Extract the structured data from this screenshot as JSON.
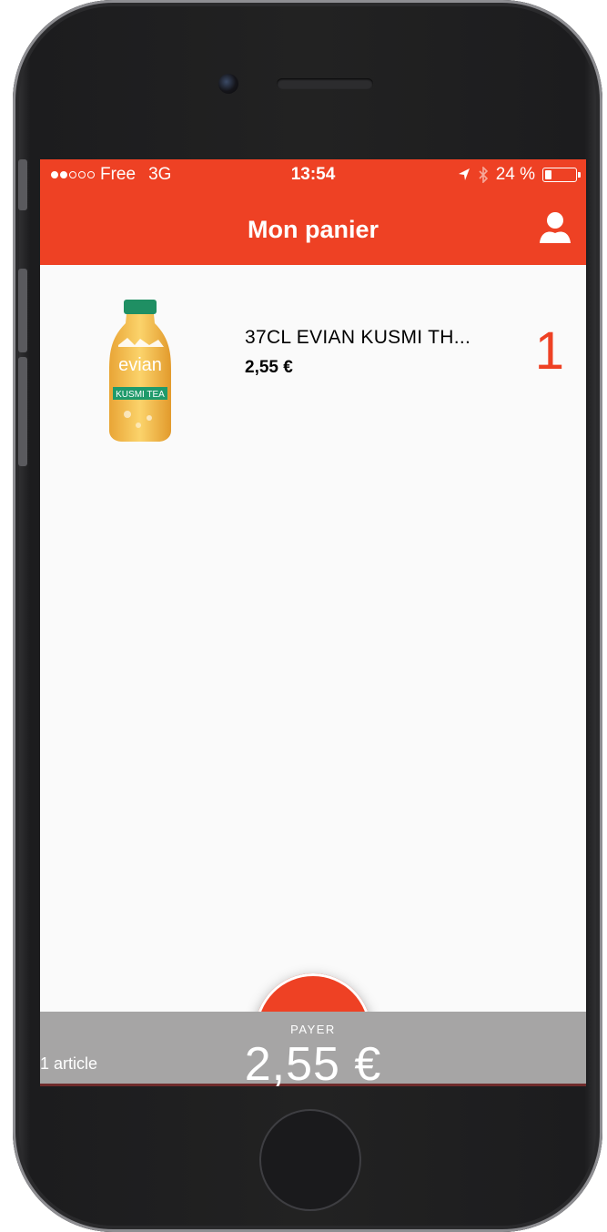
{
  "status_bar": {
    "carrier": "Free",
    "network": "3G",
    "time": "13:54",
    "battery": "24 %",
    "battery_level": 0.24,
    "signal_bars_filled": 2,
    "signal_bars_total": 5
  },
  "header": {
    "title": "Mon panier",
    "profile_icon": "user-icon"
  },
  "cart": {
    "items": [
      {
        "name": "37CL EVIAN KUSMI TH...",
        "price": "2,55 €",
        "quantity": "1",
        "image_brand_text": "evian",
        "image_label_text": "KUSMI TEA"
      }
    ]
  },
  "scan_button": {
    "icon": "barcode-scan-icon"
  },
  "footer": {
    "pay_label": "PAYER",
    "article_count": "1 article",
    "total": "2,55 €"
  },
  "colors": {
    "accent": "#ee4124",
    "footer_bg": "#a6a5a5"
  }
}
